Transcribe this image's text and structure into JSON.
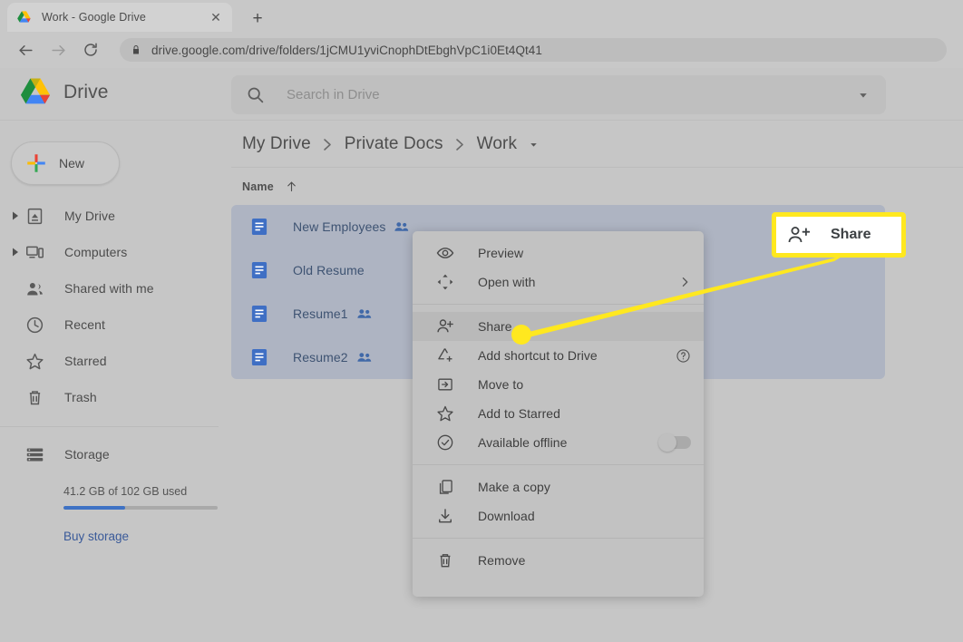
{
  "browser": {
    "tab": {
      "title": "Work - Google Drive",
      "favicon": "google-drive-favicon",
      "close_label": "✕"
    },
    "new_tab_label": "+",
    "back_label": "←",
    "forward_label": "→",
    "reload_label": "⟳",
    "url": "drive.google.com/drive/folders/1jCMU1yviCnophDtEbghVpC1i0Et4Qt41",
    "security_icon": "lock-icon"
  },
  "app": {
    "brand_name": "Drive",
    "search": {
      "placeholder": "Search in Drive",
      "icon": "search-icon",
      "caret_icon": "chevron-down-icon"
    },
    "new_button": {
      "label": "New",
      "icon": "plus-icon"
    }
  },
  "sidebar": {
    "items": [
      {
        "label": "My Drive",
        "icon": "drive-icon",
        "expandable": true
      },
      {
        "label": "Computers",
        "icon": "computer-icon",
        "expandable": true
      },
      {
        "label": "Shared with me",
        "icon": "people-icon",
        "expandable": false
      },
      {
        "label": "Recent",
        "icon": "clock-icon",
        "expandable": false
      },
      {
        "label": "Starred",
        "icon": "star-icon",
        "expandable": false
      },
      {
        "label": "Trash",
        "icon": "trash-icon",
        "expandable": false
      },
      {
        "label": "Storage",
        "icon": "storage-icon",
        "expandable": false
      }
    ],
    "storage": {
      "usage_text": "41.2 GB of 102 GB used",
      "percent": 40,
      "bar_color": "#3f72c4",
      "buy_link": "Buy storage"
    }
  },
  "main": {
    "breadcrumb": {
      "items": [
        "My Drive",
        "Private Docs",
        "Work"
      ],
      "separator": "›",
      "caret_icon": "chevron-down-icon"
    },
    "list_header": {
      "name_column": "Name",
      "sort_icon": "arrow-up-icon"
    },
    "files": [
      {
        "name": "New Employees",
        "icon": "google-docs-icon",
        "shared": true
      },
      {
        "name": "Old Resume",
        "icon": "google-docs-icon",
        "shared": false
      },
      {
        "name": "Resume1",
        "icon": "google-docs-icon",
        "shared": true
      },
      {
        "name": "Resume2",
        "icon": "google-docs-icon",
        "shared": true
      }
    ],
    "selection_color": "#aeb4c2"
  },
  "context_menu": {
    "items": [
      {
        "label": "Preview",
        "icon": "eye-icon",
        "right": "none",
        "highlight": false
      },
      {
        "label": "Open with",
        "icon": "open-with-icon",
        "right": "caret",
        "highlight": false
      },
      {
        "label": "Share",
        "icon": "person-add-icon",
        "right": "none",
        "highlight": true
      },
      {
        "label": "Add shortcut to Drive",
        "icon": "shortcut-icon",
        "right": "help",
        "highlight": false
      },
      {
        "label": "Move to",
        "icon": "move-to-icon",
        "right": "none",
        "highlight": false
      },
      {
        "label": "Add to Starred",
        "icon": "star-icon",
        "right": "none",
        "highlight": false
      },
      {
        "label": "Available offline",
        "icon": "offline-check-icon",
        "right": "toggle",
        "highlight": false
      },
      {
        "label": "Make a copy",
        "icon": "copy-icon",
        "right": "none",
        "highlight": false
      },
      {
        "label": "Download",
        "icon": "download-icon",
        "right": "none",
        "highlight": false
      },
      {
        "label": "Remove",
        "icon": "trash-icon",
        "right": "none",
        "highlight": false
      }
    ],
    "separators_after": [
      1,
      6,
      8
    ],
    "submenu_caret": "›",
    "help_label": "?"
  },
  "annotation": {
    "callout_label": "Share",
    "callout_icon": "person-add-icon",
    "highlight_color": "#ffe81f",
    "callout_bg": "#ffffff"
  }
}
